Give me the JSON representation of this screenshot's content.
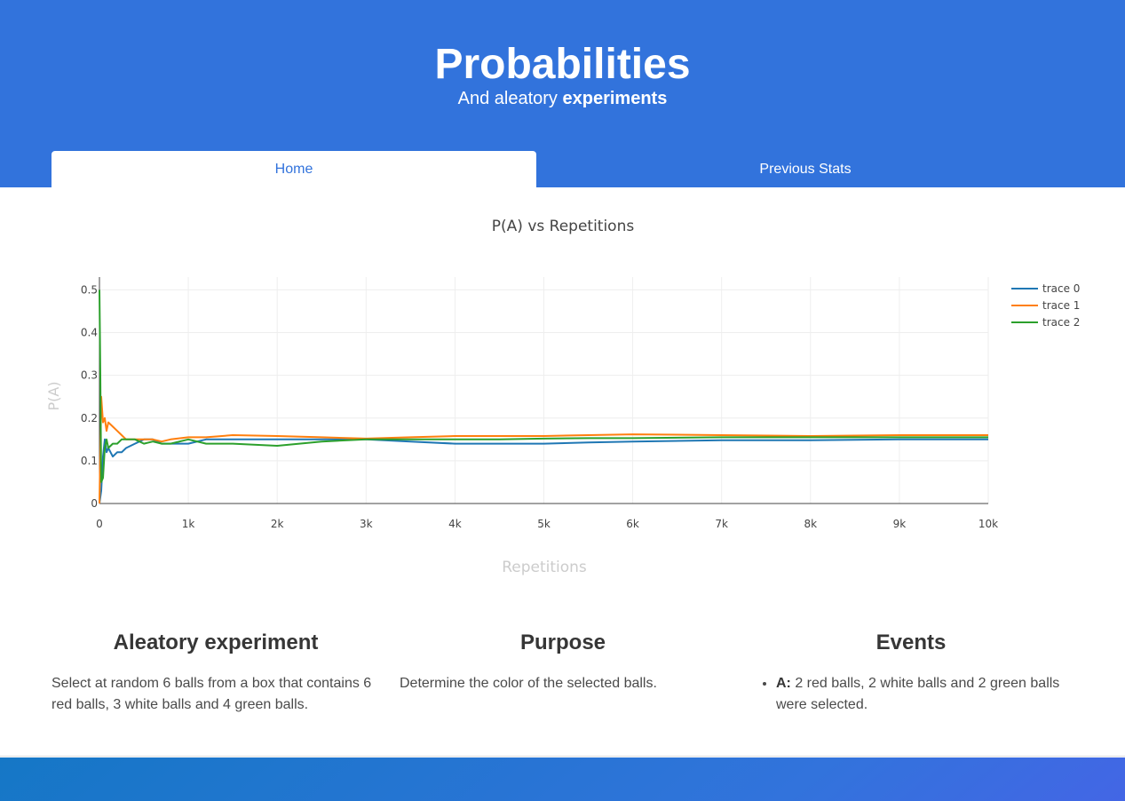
{
  "hero": {
    "title": "Probabilities",
    "subtitle_prefix": "And aleatory ",
    "subtitle_strong": "experiments"
  },
  "tabs": [
    {
      "label": "Home",
      "active": true
    },
    {
      "label": "Previous Stats",
      "active": false
    }
  ],
  "chart_data": {
    "type": "line",
    "title": "P(A) vs Repetitions",
    "xlabel": "Repetitions",
    "ylabel": "P(A)",
    "xlim": [
      0,
      10000
    ],
    "ylim": [
      0,
      0.53
    ],
    "xticks": [
      0,
      1000,
      2000,
      3000,
      4000,
      5000,
      6000,
      7000,
      8000,
      9000,
      10000
    ],
    "xtick_labels": [
      "0",
      "1k",
      "2k",
      "3k",
      "4k",
      "5k",
      "6k",
      "7k",
      "8k",
      "9k",
      "10k"
    ],
    "yticks": [
      0,
      0.1,
      0.2,
      0.3,
      0.4,
      0.5
    ],
    "ytick_labels": [
      "0",
      "0.1",
      "0.2",
      "0.3",
      "0.4",
      "0.5"
    ],
    "grid": true,
    "legend_position": "top-right",
    "series": [
      {
        "name": "trace 0",
        "color": "#1f77b4",
        "x": [
          0,
          20,
          40,
          60,
          80,
          100,
          150,
          200,
          250,
          300,
          400,
          500,
          600,
          700,
          800,
          1000,
          1200,
          1500,
          2000,
          2500,
          3000,
          3500,
          4000,
          4500,
          5000,
          5500,
          6000,
          7000,
          8000,
          9000,
          10000
        ],
        "y": [
          0.0,
          0.03,
          0.11,
          0.15,
          0.12,
          0.13,
          0.11,
          0.12,
          0.12,
          0.13,
          0.14,
          0.15,
          0.15,
          0.14,
          0.14,
          0.14,
          0.15,
          0.15,
          0.15,
          0.15,
          0.15,
          0.145,
          0.14,
          0.14,
          0.14,
          0.143,
          0.145,
          0.148,
          0.148,
          0.15,
          0.15
        ]
      },
      {
        "name": "trace 1",
        "color": "#ff7f0e",
        "x": [
          0,
          20,
          40,
          60,
          80,
          100,
          150,
          200,
          250,
          300,
          400,
          500,
          600,
          700,
          800,
          1000,
          1200,
          1500,
          2000,
          2500,
          3000,
          3500,
          4000,
          4500,
          5000,
          5500,
          6000,
          7000,
          8000,
          9000,
          10000
        ],
        "y": [
          0.0,
          0.25,
          0.19,
          0.2,
          0.17,
          0.19,
          0.18,
          0.17,
          0.16,
          0.15,
          0.15,
          0.15,
          0.15,
          0.145,
          0.15,
          0.155,
          0.155,
          0.16,
          0.158,
          0.155,
          0.152,
          0.155,
          0.158,
          0.158,
          0.158,
          0.16,
          0.162,
          0.16,
          0.158,
          0.16,
          0.16
        ]
      },
      {
        "name": "trace 2",
        "color": "#2ca02c",
        "x": [
          0,
          10,
          20,
          40,
          60,
          80,
          100,
          150,
          200,
          250,
          300,
          400,
          500,
          600,
          700,
          800,
          1000,
          1200,
          1500,
          2000,
          2500,
          3000,
          3500,
          4000,
          4500,
          5000,
          5500,
          6000,
          7000,
          8000,
          9000,
          10000
        ],
        "y": [
          0.5,
          0.3,
          0.05,
          0.06,
          0.13,
          0.15,
          0.13,
          0.14,
          0.14,
          0.15,
          0.15,
          0.15,
          0.14,
          0.145,
          0.14,
          0.14,
          0.15,
          0.14,
          0.14,
          0.135,
          0.145,
          0.15,
          0.15,
          0.15,
          0.15,
          0.152,
          0.153,
          0.153,
          0.155,
          0.155,
          0.155,
          0.155
        ]
      }
    ]
  },
  "sections": {
    "experiment": {
      "title": "Aleatory experiment",
      "text": "Select at random 6 balls from a box that contains 6 red balls, 3 white balls and 4 green balls."
    },
    "purpose": {
      "title": "Purpose",
      "text": "Determine the color of the selected balls."
    },
    "events": {
      "title": "Events",
      "items": [
        {
          "label": "A:",
          "text": " 2 red balls, 2 white balls and 2 green balls were selected."
        }
      ]
    }
  }
}
